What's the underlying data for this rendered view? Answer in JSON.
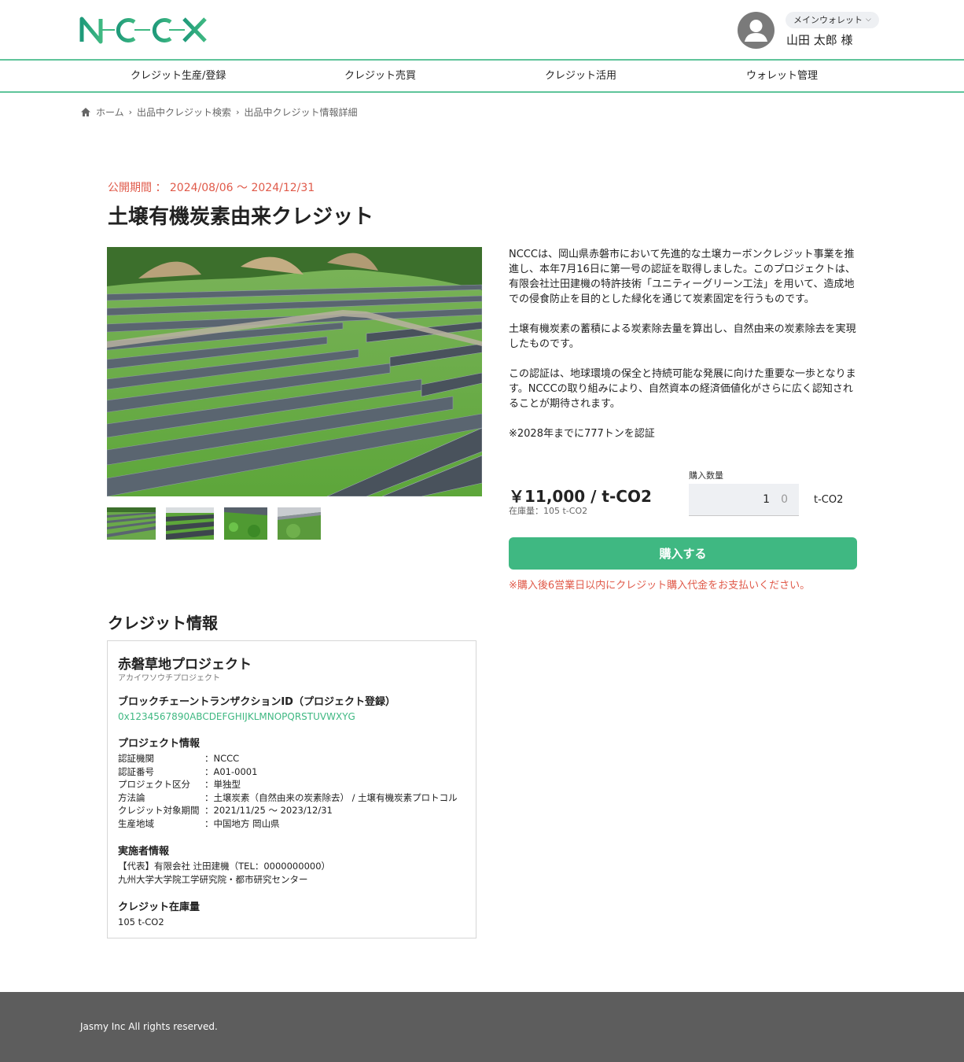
{
  "header": {
    "logo_text": "NCCX",
    "wallet_label": "メインウォレット",
    "user_name": "山田 太郎 様"
  },
  "nav": {
    "items": [
      {
        "label": "クレジット生産/登録"
      },
      {
        "label": "クレジット売買"
      },
      {
        "label": "クレジット活用"
      },
      {
        "label": "ウォレット管理"
      }
    ]
  },
  "breadcrumb": {
    "items": [
      "ホーム",
      "出品中クレジット検索",
      "出品中クレジット情報詳細"
    ]
  },
  "listing": {
    "period": "公開期間 ： 2024/08/06 〜 2024/12/31",
    "title": "土壌有機炭素由来クレジット",
    "description": [
      "NCCCは、岡山県赤磐市において先進的な土壌カーボンクレジット事業を推進し、本年7月16日に第一号の認証を取得しました。このプロジェクトは、有限会社辻田建機の特許技術「ユニティーグリーン工法」を用いて、造成地での侵食防止を目的とした緑化を通じて炭素固定を行うものです。",
      "土壌有機炭素の蓄積による炭素除去量を算出し、自然由来の炭素除去を実現したものです。",
      "この認証は、地球環境の保全と持続可能な発展に向けた重要な一歩となります。NCCCの取り組みにより、自然資本の経済価値化がさらに広く認知されることが期待されます。",
      "※2028年までに777トンを認証"
    ],
    "price": "￥11,000 / t-CO2",
    "stock": "在庫量：105 t-CO2",
    "qty_label": "購入数量",
    "qty_value": "1",
    "qty_second": "0",
    "qty_unit": "t-CO2",
    "buy_label": "購入する",
    "buy_note": "※購入後6営業日以内にクレジット購入代金をお支払いください。"
  },
  "credit": {
    "section_title": "クレジット情報",
    "project_name": "赤磐草地プロジェクト",
    "project_kana": "アカイワソウチプロジェクト",
    "tx_heading": "ブロックチェーントランザクションID（プロジェクト登録）",
    "tx_id": "0x1234567890ABCDEFGHIJKLMNOPQRSTUVWXYG",
    "project_info_heading": "プロジェクト情報",
    "project_info": [
      {
        "key": "認証機関",
        "value": "：NCCC"
      },
      {
        "key": "認証番号",
        "value": "：A01-0001"
      },
      {
        "key": "プロジェクト区分",
        "value": "：単独型"
      },
      {
        "key": "方法論",
        "value": "：土壌炭素（自然由来の炭素除去） / 土壌有機炭素プロトコル"
      },
      {
        "key": "クレジット対象期間",
        "value": "：2021/11/25 〜 2023/12/31"
      },
      {
        "key": "生産地域",
        "value": "：中国地方 岡山県"
      }
    ],
    "implementer_heading": "実施者情報",
    "implementers": [
      "【代表】有限会社 辻田建機（TEL：0000000000）",
      "九州大学大学院工学研究院・都市研究センター"
    ],
    "stock_heading": "クレジット在庫量",
    "stock_value": "105 t-CO2"
  },
  "footer": {
    "copyright": "Jasmy Inc All rights reserved."
  },
  "colors": {
    "brand_green": "#3fb882",
    "nav_line": "#5fc49a",
    "alert_red": "#e05a4a",
    "footer_bg": "#5d5d5d"
  }
}
